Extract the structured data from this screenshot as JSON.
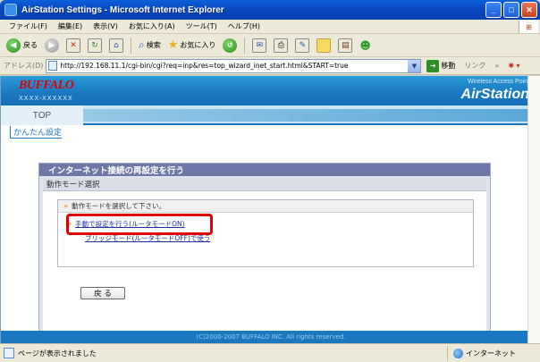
{
  "window": {
    "title": "AirStation Settings - Microsoft Internet Explorer"
  },
  "menu": [
    "ファイル(F)",
    "編集(E)",
    "表示(V)",
    "お気に入り(A)",
    "ツール(T)",
    "ヘルプ(H)"
  ],
  "toolbar": {
    "back_label": "戻る",
    "search_label": "検索",
    "favorites_label": "お気に入り"
  },
  "address": {
    "label": "アドレス(D)",
    "url": "http://192.168.11.1/cgi-bin/cgi?req=inp&res=top_wizard_inet_start.html&START=true",
    "go_label": "移動",
    "links_label": "リンク"
  },
  "banner": {
    "brand": "BUFFALO",
    "model": "XXXX-XXXXXX",
    "wap": "Wireless Access Point",
    "product": "AirStation"
  },
  "nav": {
    "top_tab": "TOP",
    "sub_item": "かんたん設定"
  },
  "panel": {
    "title": "インターネット接続の再設定を行う",
    "section": "動作モード選択",
    "instruction": "動作モードを選択して下さい。",
    "option1": "手動で設定を行う(ルータモードON)",
    "option2": "ブリッジモード(ルータモードOFF)で使う"
  },
  "back_button": "戻 る",
  "footer": "(C)2000-2007 BUFFALO INC. All rights reserved.",
  "status": {
    "text": "ページが表示されました",
    "zone": "インターネット"
  }
}
